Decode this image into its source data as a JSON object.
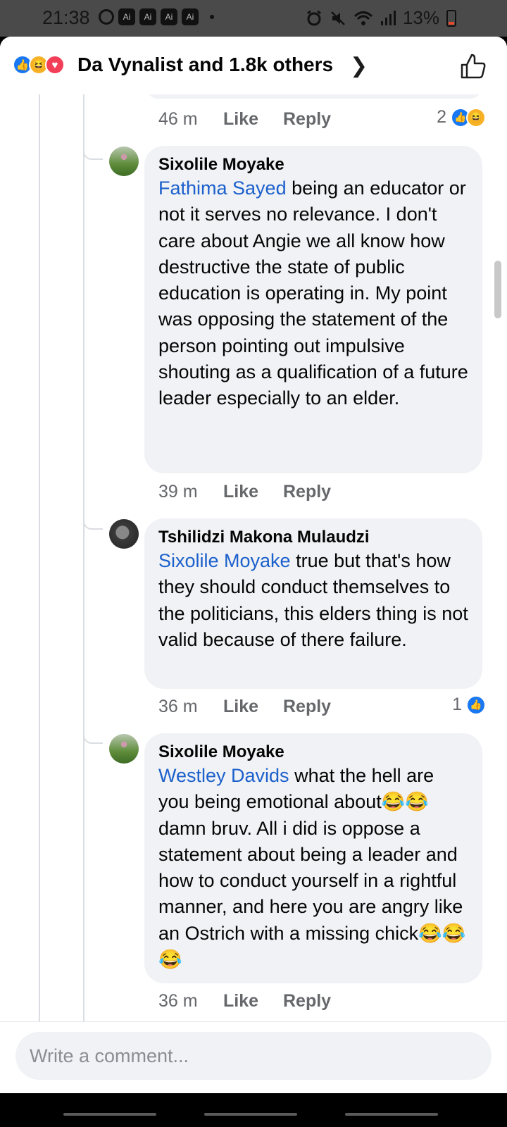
{
  "status_bar": {
    "time": "21:38",
    "ai_badges": [
      "Ai",
      "Ai",
      "Ai",
      "Ai"
    ],
    "battery": "13%",
    "icons": [
      "alarm-icon",
      "mute-icon",
      "wifi-icon",
      "signal-icon",
      "battery-icon"
    ]
  },
  "header": {
    "reactors_text": "Da Vynalist and 1.8k others",
    "reaction_icons": [
      "like-icon",
      "haha-icon",
      "love-icon"
    ]
  },
  "comments": [
    {
      "meta": {
        "time": "46 m",
        "like": "Like",
        "reply": "Reply",
        "reaction_count": "2"
      }
    },
    {
      "author": "Sixolile Moyake",
      "mention": "Fathima Sayed",
      "text": " being an educator or not it serves no relevance. I don't care about Angie we all know how destructive the state of public education is operating in. My point was opposing the statement of the person pointing out impulsive shouting as a qualification of a future leader especially to an elder.",
      "meta": {
        "time": "39 m",
        "like": "Like",
        "reply": "Reply"
      }
    },
    {
      "author": "Tshilidzi Makona Mulaudzi",
      "mention": "Sixolile Moyake",
      "text": " true but that's how they should conduct themselves to the politicians, this elders thing is not valid because of there failure.",
      "meta": {
        "time": "36 m",
        "like": "Like",
        "reply": "Reply",
        "reaction_count": "1"
      }
    },
    {
      "author": "Sixolile Moyake",
      "mention": "Westley Davids",
      "text": " what the hell are you being emotional about😂😂 damn bruv. All i did is oppose a statement about being a leader and how to conduct yourself in a rightful manner, and here you are angry like an Ostrich with a missing chick😂😂😂",
      "meta": {
        "time": "36 m",
        "like": "Like",
        "reply": "Reply"
      }
    }
  ],
  "composer": {
    "placeholder": "Write a comment..."
  },
  "colors": {
    "accent": "#1877f2",
    "mention": "#1c60cc",
    "bubble": "#f0f2f5",
    "meta_text": "#65676b"
  }
}
